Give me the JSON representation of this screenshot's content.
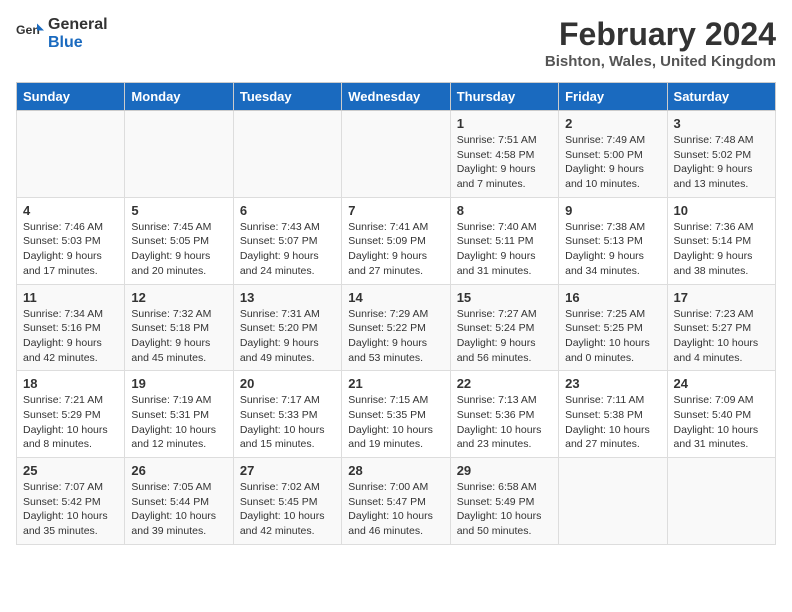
{
  "header": {
    "logo_line1": "General",
    "logo_line2": "Blue",
    "main_title": "February 2024",
    "subtitle": "Bishton, Wales, United Kingdom"
  },
  "days_of_week": [
    "Sunday",
    "Monday",
    "Tuesday",
    "Wednesday",
    "Thursday",
    "Friday",
    "Saturday"
  ],
  "weeks": [
    [
      {
        "day": "",
        "info": ""
      },
      {
        "day": "",
        "info": ""
      },
      {
        "day": "",
        "info": ""
      },
      {
        "day": "",
        "info": ""
      },
      {
        "day": "1",
        "info": "Sunrise: 7:51 AM\nSunset: 4:58 PM\nDaylight: 9 hours and 7 minutes."
      },
      {
        "day": "2",
        "info": "Sunrise: 7:49 AM\nSunset: 5:00 PM\nDaylight: 9 hours and 10 minutes."
      },
      {
        "day": "3",
        "info": "Sunrise: 7:48 AM\nSunset: 5:02 PM\nDaylight: 9 hours and 13 minutes."
      }
    ],
    [
      {
        "day": "4",
        "info": "Sunrise: 7:46 AM\nSunset: 5:03 PM\nDaylight: 9 hours and 17 minutes."
      },
      {
        "day": "5",
        "info": "Sunrise: 7:45 AM\nSunset: 5:05 PM\nDaylight: 9 hours and 20 minutes."
      },
      {
        "day": "6",
        "info": "Sunrise: 7:43 AM\nSunset: 5:07 PM\nDaylight: 9 hours and 24 minutes."
      },
      {
        "day": "7",
        "info": "Sunrise: 7:41 AM\nSunset: 5:09 PM\nDaylight: 9 hours and 27 minutes."
      },
      {
        "day": "8",
        "info": "Sunrise: 7:40 AM\nSunset: 5:11 PM\nDaylight: 9 hours and 31 minutes."
      },
      {
        "day": "9",
        "info": "Sunrise: 7:38 AM\nSunset: 5:13 PM\nDaylight: 9 hours and 34 minutes."
      },
      {
        "day": "10",
        "info": "Sunrise: 7:36 AM\nSunset: 5:14 PM\nDaylight: 9 hours and 38 minutes."
      }
    ],
    [
      {
        "day": "11",
        "info": "Sunrise: 7:34 AM\nSunset: 5:16 PM\nDaylight: 9 hours and 42 minutes."
      },
      {
        "day": "12",
        "info": "Sunrise: 7:32 AM\nSunset: 5:18 PM\nDaylight: 9 hours and 45 minutes."
      },
      {
        "day": "13",
        "info": "Sunrise: 7:31 AM\nSunset: 5:20 PM\nDaylight: 9 hours and 49 minutes."
      },
      {
        "day": "14",
        "info": "Sunrise: 7:29 AM\nSunset: 5:22 PM\nDaylight: 9 hours and 53 minutes."
      },
      {
        "day": "15",
        "info": "Sunrise: 7:27 AM\nSunset: 5:24 PM\nDaylight: 9 hours and 56 minutes."
      },
      {
        "day": "16",
        "info": "Sunrise: 7:25 AM\nSunset: 5:25 PM\nDaylight: 10 hours and 0 minutes."
      },
      {
        "day": "17",
        "info": "Sunrise: 7:23 AM\nSunset: 5:27 PM\nDaylight: 10 hours and 4 minutes."
      }
    ],
    [
      {
        "day": "18",
        "info": "Sunrise: 7:21 AM\nSunset: 5:29 PM\nDaylight: 10 hours and 8 minutes."
      },
      {
        "day": "19",
        "info": "Sunrise: 7:19 AM\nSunset: 5:31 PM\nDaylight: 10 hours and 12 minutes."
      },
      {
        "day": "20",
        "info": "Sunrise: 7:17 AM\nSunset: 5:33 PM\nDaylight: 10 hours and 15 minutes."
      },
      {
        "day": "21",
        "info": "Sunrise: 7:15 AM\nSunset: 5:35 PM\nDaylight: 10 hours and 19 minutes."
      },
      {
        "day": "22",
        "info": "Sunrise: 7:13 AM\nSunset: 5:36 PM\nDaylight: 10 hours and 23 minutes."
      },
      {
        "day": "23",
        "info": "Sunrise: 7:11 AM\nSunset: 5:38 PM\nDaylight: 10 hours and 27 minutes."
      },
      {
        "day": "24",
        "info": "Sunrise: 7:09 AM\nSunset: 5:40 PM\nDaylight: 10 hours and 31 minutes."
      }
    ],
    [
      {
        "day": "25",
        "info": "Sunrise: 7:07 AM\nSunset: 5:42 PM\nDaylight: 10 hours and 35 minutes."
      },
      {
        "day": "26",
        "info": "Sunrise: 7:05 AM\nSunset: 5:44 PM\nDaylight: 10 hours and 39 minutes."
      },
      {
        "day": "27",
        "info": "Sunrise: 7:02 AM\nSunset: 5:45 PM\nDaylight: 10 hours and 42 minutes."
      },
      {
        "day": "28",
        "info": "Sunrise: 7:00 AM\nSunset: 5:47 PM\nDaylight: 10 hours and 46 minutes."
      },
      {
        "day": "29",
        "info": "Sunrise: 6:58 AM\nSunset: 5:49 PM\nDaylight: 10 hours and 50 minutes."
      },
      {
        "day": "",
        "info": ""
      },
      {
        "day": "",
        "info": ""
      }
    ]
  ]
}
